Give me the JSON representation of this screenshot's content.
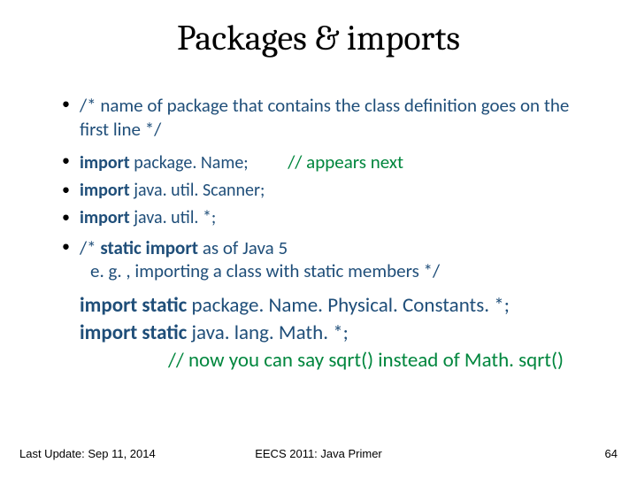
{
  "title": "Packages & imports",
  "bullets": {
    "b1_comment": "/* name of package that contains the class definition goes on the first line */",
    "b2_kw": "import",
    "b2_rest": "  package. Name;",
    "b2_note": "// appears next",
    "b3_kw": "import",
    "b3_rest": "  java. util. Scanner;",
    "b4_kw": "import",
    "b4_rest": "  java. util. *;",
    "b5_prefix": "/* ",
    "b5_strong": "static import",
    "b5_suffix": " as of Java 5",
    "b5_sub": "e. g. , importing a class with static members */"
  },
  "tail": {
    "l1_kw": "import  static",
    "l1_rest": "  package. Name. Physical. Constants. *;",
    "l2_kw": "import  static",
    "l2_rest": "  java. lang. Math. *;",
    "l3": "// now you can say  sqrt() instead of Math. sqrt()"
  },
  "footer": {
    "left": "Last Update: Sep 11, 2014",
    "center": "EECS 2011: Java Primer",
    "right": "64"
  }
}
